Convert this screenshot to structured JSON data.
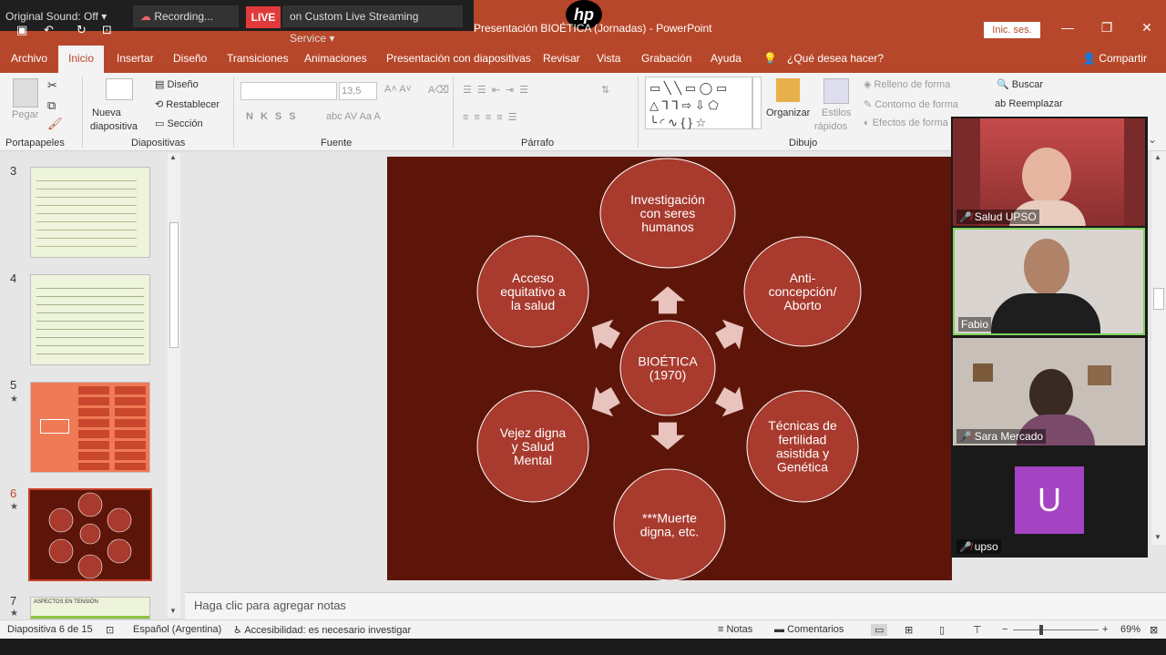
{
  "zoom_bar": {
    "original_sound": "Original Sound: Off",
    "recording": "Recording...",
    "live": "LIVE",
    "streaming": "on Custom Live Streaming Service"
  },
  "window": {
    "title": "Presentación BIOÉTICA (Jornadas)  -  PowerPoint",
    "sign_in": "Inic. ses.",
    "hp": "hp"
  },
  "menu": {
    "tabs": [
      "Archivo",
      "Inicio",
      "Insertar",
      "Diseño",
      "Transiciones",
      "Animaciones",
      "Presentación con diapositivas",
      "Revisar",
      "Vista",
      "Grabación",
      "Ayuda"
    ],
    "search": "¿Qué desea hacer?",
    "share": "Compartir"
  },
  "ribbon": {
    "paste": "Pegar",
    "new_slide_1": "Nueva",
    "new_slide_2": "diapositiva",
    "layout": "Diseño",
    "reset": "Restablecer",
    "section": "Sección",
    "font_size": "13,5",
    "organize": "Organizar",
    "styles_1": "Estilos",
    "styles_2": "rápidos",
    "fill": "Relleno de forma",
    "outline": "Contorno de forma",
    "effects": "Efectos de forma",
    "find": "Buscar",
    "replace": "Reemplazar",
    "groups": {
      "clipboard": "Portapapeles",
      "slides": "Diapositivas",
      "font": "Fuente",
      "paragraph": "Párrafo",
      "drawing": "Dibujo"
    }
  },
  "thumbnails": [
    {
      "num": "3",
      "star": ""
    },
    {
      "num": "4",
      "star": ""
    },
    {
      "num": "5",
      "star": "★"
    },
    {
      "num": "6",
      "star": "★"
    },
    {
      "num": "7",
      "star": "★",
      "caption": "ASPECTOS EN TENSIÓN"
    }
  ],
  "slide": {
    "center": "BIOÉTICA\n(1970)",
    "nodes": [
      "Investigación\ncon seres\nhumanos",
      "Anti-\nconcepción/\nAborto",
      "Técnicas de\nfertilidad\nasistida y\nGenética",
      "***Muerte\ndigna, etc.",
      "Vejez digna\ny Salud\nMental",
      "Acceso\nequitativo a\nla salud"
    ]
  },
  "notes": "Haga clic para agregar notas",
  "status": {
    "slide": "Diapositiva 6 de 15",
    "language": "Español (Argentina)",
    "accessibility": "Accesibilidad: es necesario investigar",
    "notes": "Notas",
    "comments": "Comentarios",
    "zoom": "69%"
  },
  "participants": [
    {
      "name": "Salud UPSO",
      "muted": true
    },
    {
      "name": "Fabio",
      "muted": false
    },
    {
      "name": "Sara Mercado",
      "muted": true
    },
    {
      "name": "upso",
      "muted": true,
      "initial": "U"
    }
  ],
  "colors": {
    "ppt_red": "#b7472a",
    "slide_bg": "#5c1508",
    "circle": "#a83a2e",
    "avatar": "#a444c2"
  }
}
